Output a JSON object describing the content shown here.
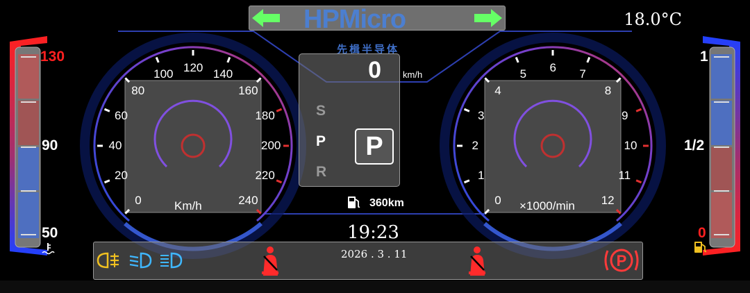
{
  "header": {
    "logo_text": "HPMicro",
    "logo_subtitle": "先楫半导体",
    "temperature": "18.0°C"
  },
  "speedometer": {
    "ticks": [
      "0",
      "20",
      "40",
      "60",
      "80",
      "100",
      "120",
      "140",
      "160",
      "180",
      "200",
      "220",
      "240"
    ],
    "unit": "Km/h",
    "value": 0
  },
  "tachometer": {
    "ticks": [
      "0",
      "1",
      "2",
      "3",
      "4",
      "5",
      "6",
      "7",
      "8",
      "9",
      "10",
      "11",
      "12"
    ],
    "unit": "×1000/min",
    "value": 0
  },
  "center": {
    "speed": "0",
    "speed_unit": "km/h",
    "gears": [
      "S",
      "P",
      "R"
    ],
    "current_gear": "P",
    "range": "360km"
  },
  "clock": {
    "time": "19:23",
    "date": "2026 . 3 . 11"
  },
  "water_temp": {
    "labels": [
      "130",
      "90",
      "50"
    ]
  },
  "fuel": {
    "labels": [
      "1",
      "1/2",
      "0"
    ]
  },
  "colors": {
    "accent_blue": "#3a5fe0",
    "warning_red": "#ff2b2b",
    "arrow_green": "#66ff66",
    "lamp_yellow": "#f0c020",
    "lamp_blue": "#3fb7ff"
  },
  "indicators": [
    "turn-left-icon",
    "turn-right-icon",
    "fog-lamp-icon",
    "low-beam-icon",
    "high-beam-icon",
    "seatbelt-warning-icon",
    "parking-brake-icon",
    "fuel-pump-icon",
    "coolant-temp-icon"
  ]
}
